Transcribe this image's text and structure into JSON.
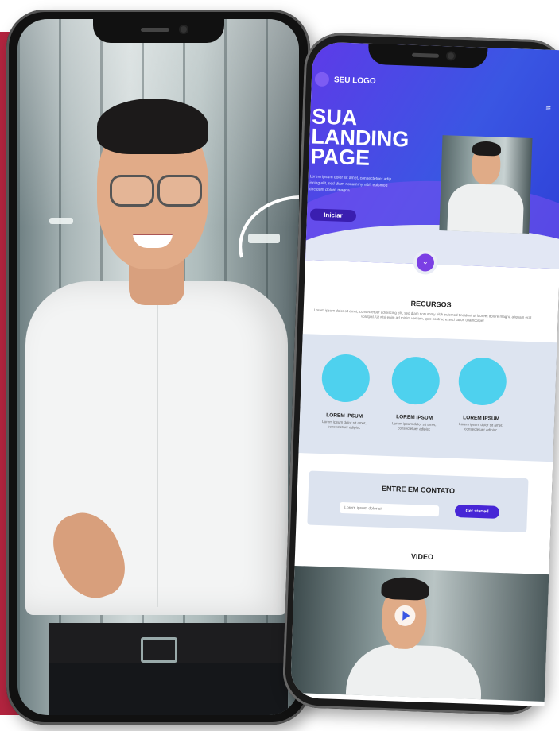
{
  "landing": {
    "logo_text": "SEU LOGO",
    "menu_icon": "hamburger-menu-icon",
    "hero_title": "SUA LANDING PAGE",
    "hero_text": "Lorem ipsum dolor sit amet, consectetuer adip iscing elit, sed diam nonummy nibh euismod tincidunt dolore magna",
    "hero_button": "Iniciar",
    "chevron_icon": "chevron-down-icon",
    "features_title": "RECURSOS",
    "features_text": "Lorem ipsum dolor sit amet, consectetuer adipiscing elit, sed diam nonummy nibh euismod tincidunt ut laoreet dolore magna aliquam erat volutpat. Ut wisi enim ad minim veniam, quis nostrud exerci tation ullamcorper",
    "features": [
      {
        "title": "LOREM IPSUM",
        "text": "Lorem ipsum dolor sit amet, consectetuer adipisc"
      },
      {
        "title": "LOREM IPSUM",
        "text": "Lorem ipsum dolor sit amet, consectetuer adipisc"
      },
      {
        "title": "LOREM IPSUM",
        "text": "Lorem ipsum dolor sit amet, consectetuer adipisc"
      }
    ],
    "contact_title": "ENTRE EM CONTATO",
    "contact_input_placeholder": "Lorem ipsum dolor sit",
    "contact_button": "Get started",
    "video_title": "VIDEO",
    "play_icon": "play-icon"
  },
  "colors": {
    "brand_red": "#b3243f",
    "hero_purple": "#5d3be8",
    "hero_blue": "#3a56e3",
    "feature_cyan": "#4ed1ee",
    "button_dark": "#3a1eb0"
  }
}
